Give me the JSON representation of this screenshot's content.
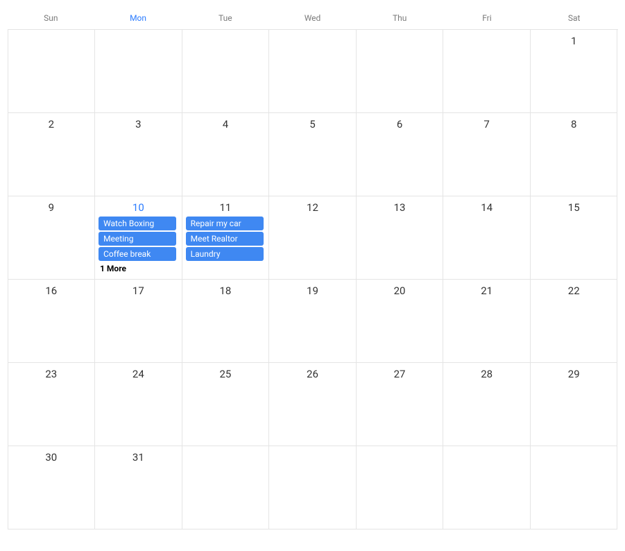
{
  "colors": {
    "event_bg": "#3f88f2",
    "accent": "#2b7cff",
    "border": "#e4e4e4",
    "muted": "#7a7a7a"
  },
  "weekdays": [
    "Sun",
    "Mon",
    "Tue",
    "Wed",
    "Thu",
    "Fri",
    "Sat"
  ],
  "today_weekday_index": 1,
  "weeks": [
    {
      "days": [
        {
          "num": "",
          "today": false,
          "events": [],
          "more": ""
        },
        {
          "num": "",
          "today": false,
          "events": [],
          "more": ""
        },
        {
          "num": "",
          "today": false,
          "events": [],
          "more": ""
        },
        {
          "num": "",
          "today": false,
          "events": [],
          "more": ""
        },
        {
          "num": "",
          "today": false,
          "events": [],
          "more": ""
        },
        {
          "num": "",
          "today": false,
          "events": [],
          "more": ""
        },
        {
          "num": "1",
          "today": false,
          "events": [],
          "more": ""
        }
      ]
    },
    {
      "days": [
        {
          "num": "2",
          "today": false,
          "events": [],
          "more": ""
        },
        {
          "num": "3",
          "today": false,
          "events": [],
          "more": ""
        },
        {
          "num": "4",
          "today": false,
          "events": [],
          "more": ""
        },
        {
          "num": "5",
          "today": false,
          "events": [],
          "more": ""
        },
        {
          "num": "6",
          "today": false,
          "events": [],
          "more": ""
        },
        {
          "num": "7",
          "today": false,
          "events": [],
          "more": ""
        },
        {
          "num": "8",
          "today": false,
          "events": [],
          "more": ""
        }
      ]
    },
    {
      "days": [
        {
          "num": "9",
          "today": false,
          "events": [],
          "more": ""
        },
        {
          "num": "10",
          "today": true,
          "events": [
            "Watch Boxing",
            "Meeting",
            "Coffee break"
          ],
          "more": "1 More"
        },
        {
          "num": "11",
          "today": false,
          "events": [
            "Repair my car",
            "Meet Realtor",
            "Laundry"
          ],
          "more": ""
        },
        {
          "num": "12",
          "today": false,
          "events": [],
          "more": ""
        },
        {
          "num": "13",
          "today": false,
          "events": [],
          "more": ""
        },
        {
          "num": "14",
          "today": false,
          "events": [],
          "more": ""
        },
        {
          "num": "15",
          "today": false,
          "events": [],
          "more": ""
        }
      ]
    },
    {
      "days": [
        {
          "num": "16",
          "today": false,
          "events": [],
          "more": ""
        },
        {
          "num": "17",
          "today": false,
          "events": [],
          "more": ""
        },
        {
          "num": "18",
          "today": false,
          "events": [],
          "more": ""
        },
        {
          "num": "19",
          "today": false,
          "events": [],
          "more": ""
        },
        {
          "num": "20",
          "today": false,
          "events": [],
          "more": ""
        },
        {
          "num": "21",
          "today": false,
          "events": [],
          "more": ""
        },
        {
          "num": "22",
          "today": false,
          "events": [],
          "more": ""
        }
      ]
    },
    {
      "days": [
        {
          "num": "23",
          "today": false,
          "events": [],
          "more": ""
        },
        {
          "num": "24",
          "today": false,
          "events": [],
          "more": ""
        },
        {
          "num": "25",
          "today": false,
          "events": [],
          "more": ""
        },
        {
          "num": "26",
          "today": false,
          "events": [],
          "more": ""
        },
        {
          "num": "27",
          "today": false,
          "events": [],
          "more": ""
        },
        {
          "num": "28",
          "today": false,
          "events": [],
          "more": ""
        },
        {
          "num": "29",
          "today": false,
          "events": [],
          "more": ""
        }
      ]
    },
    {
      "days": [
        {
          "num": "30",
          "today": false,
          "events": [],
          "more": ""
        },
        {
          "num": "31",
          "today": false,
          "events": [],
          "more": ""
        },
        {
          "num": "",
          "today": false,
          "events": [],
          "more": ""
        },
        {
          "num": "",
          "today": false,
          "events": [],
          "more": ""
        },
        {
          "num": "",
          "today": false,
          "events": [],
          "more": ""
        },
        {
          "num": "",
          "today": false,
          "events": [],
          "more": ""
        },
        {
          "num": "",
          "today": false,
          "events": [],
          "more": ""
        }
      ]
    }
  ]
}
